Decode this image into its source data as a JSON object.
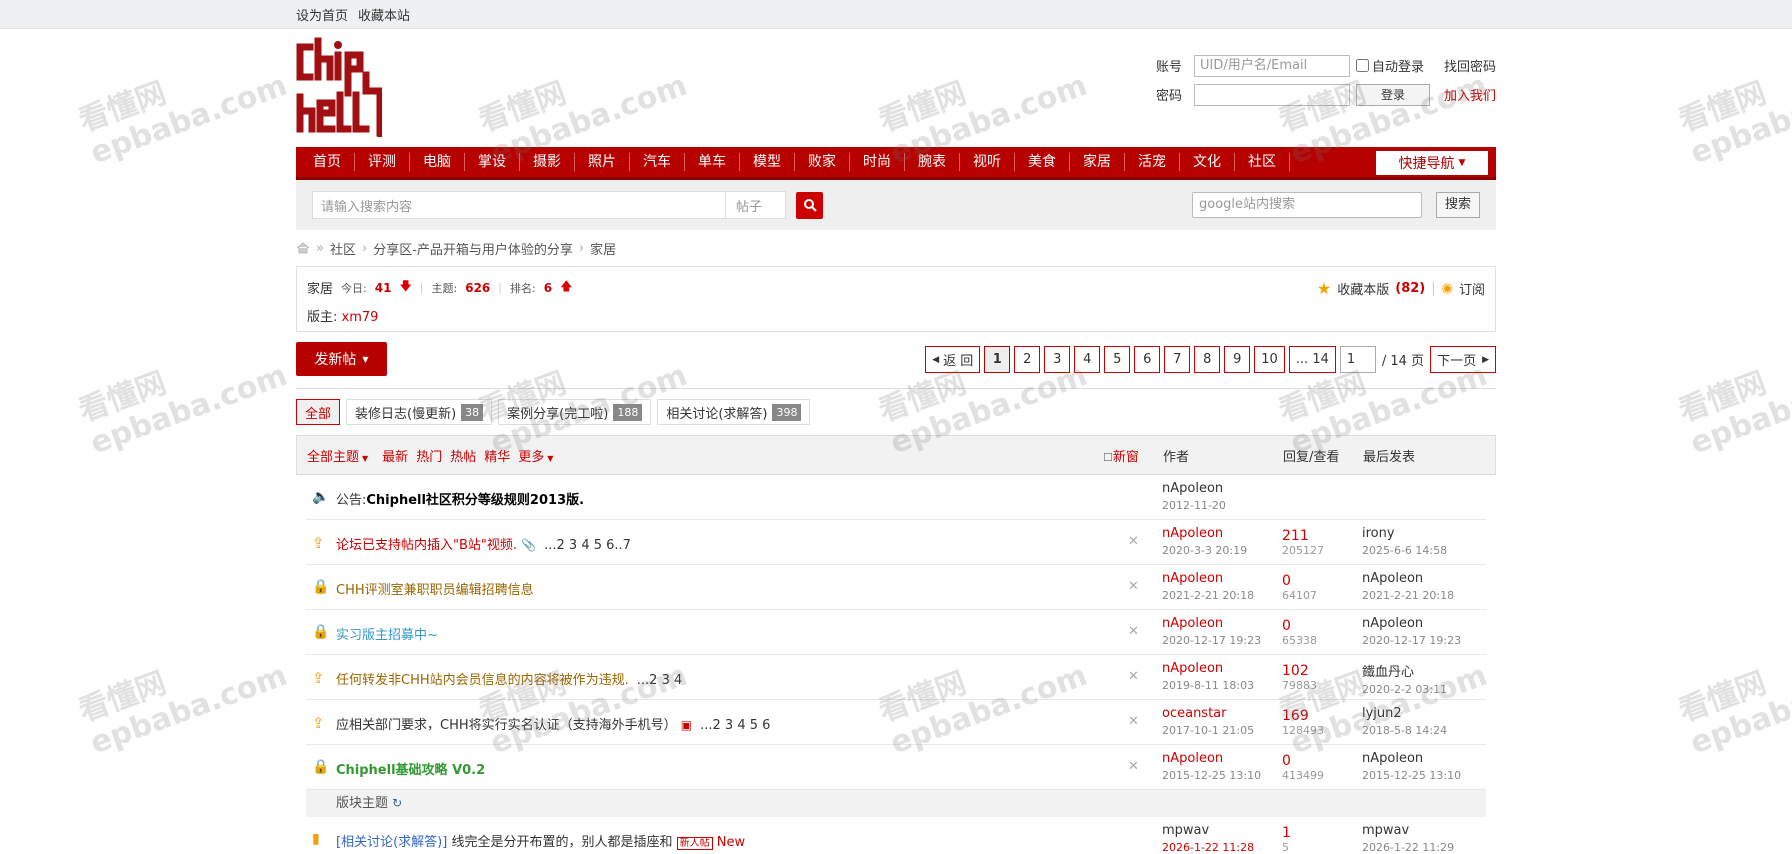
{
  "topbar": {
    "set_home": "设为首页",
    "bookmark": "收藏本站"
  },
  "login": {
    "account_label": "账号",
    "account_placeholder": "UID/用户名/Email",
    "auto_login": "自动登录",
    "find_password": "找回密码",
    "password_label": "密码",
    "login_button": "登录",
    "join_us": "加入我们"
  },
  "nav": {
    "items": [
      "首页",
      "评测",
      "电脑",
      "掌设",
      "摄影",
      "照片",
      "汽车",
      "单车",
      "模型",
      "败家",
      "时尚",
      "腕表",
      "视听",
      "美食",
      "家居",
      "活宠",
      "文化",
      "社区"
    ],
    "quick": "快捷导航"
  },
  "search": {
    "placeholder": "请输入搜索内容",
    "type": "帖子",
    "google_placeholder": "google站内搜索",
    "google_button": "搜索"
  },
  "breadcrumb": {
    "items": [
      "社区",
      "分享区-产品开箱与用户体验的分享",
      "家居"
    ]
  },
  "forum": {
    "name": "家居",
    "today_label": "今日:",
    "today": "41",
    "threads_label": "主题:",
    "threads": "626",
    "rank_label": "排名:",
    "rank": "6",
    "moderator_label": "版主:",
    "moderator": "xm79",
    "favorite_label": "收藏本版",
    "favorite_count": "(82)",
    "subscribe": "订阅"
  },
  "toolbar": {
    "post_button": "发新帖"
  },
  "pager": {
    "back": "返 回",
    "pages": [
      "1",
      "2",
      "3",
      "4",
      "5",
      "6",
      "7",
      "8",
      "9",
      "10",
      "... 14"
    ],
    "current": "1",
    "total": "/ 14 页",
    "next": "下一页"
  },
  "tabs": [
    {
      "label": "全部",
      "count": ""
    },
    {
      "label": "装修日志(慢更新)",
      "count": "38"
    },
    {
      "label": "案例分享(完工啦)",
      "count": "188"
    },
    {
      "label": "相关讨论(求解答)",
      "count": "398"
    }
  ],
  "thread_header": {
    "filters": [
      "全部主题",
      "最新",
      "热门",
      "热帖",
      "精华",
      "更多"
    ],
    "new_window": "新窗",
    "author": "作者",
    "replies": "回复/查看",
    "last_post": "最后发表"
  },
  "threads": [
    {
      "prefix": "公告:",
      "title": "Chiphell社区积分等级规则2013版.",
      "pages": "",
      "author": "nApoleon",
      "date": "2012-11-20",
      "replies": "",
      "views": "",
      "last_author": "",
      "last_date": "",
      "color": "#000"
    },
    {
      "prefix": "",
      "title": "论坛已支持帖内插入\"B站\"视频.",
      "pages": "...2 3 4 5 6..7",
      "author": "nApoleon",
      "date": "2020-3-3 20:19",
      "replies": "211",
      "views": "205127",
      "last_author": "irony",
      "last_date": "2025-6-6 14:58",
      "color": "#c00"
    },
    {
      "prefix": "",
      "title": "CHH评测室兼职职员编辑招聘信息",
      "pages": "",
      "author": "nApoleon",
      "date": "2021-2-21 20:18",
      "replies": "0",
      "views": "64107",
      "last_author": "nApoleon",
      "last_date": "2021-2-21 20:18",
      "color": "#996600"
    },
    {
      "prefix": "",
      "title": "实习版主招募中~",
      "pages": "",
      "author": "nApoleon",
      "date": "2020-12-17 19:23",
      "replies": "0",
      "views": "65338",
      "last_author": "nApoleon",
      "last_date": "2020-12-17 19:23",
      "color": "#3399cc"
    },
    {
      "prefix": "",
      "title": "任何转发非CHH站内会员信息的内容将被作为违规.",
      "pages": "...2 3 4",
      "author": "nApoleon",
      "date": "2019-8-11 18:03",
      "replies": "102",
      "views": "79883",
      "last_author": "鐵血丹心",
      "last_date": "2020-2-2 03:11",
      "color": "#996600"
    },
    {
      "prefix": "",
      "title": "应相关部门要求，CHH将实行实名认证（支持海外手机号）",
      "pages": "...2 3 4 5 6",
      "author": "oceanstar",
      "date": "2017-10-1 21:05",
      "replies": "169",
      "views": "128493",
      "last_author": "lyjun2",
      "last_date": "2018-5-8 14:24",
      "color": "#333"
    },
    {
      "prefix": "",
      "title": "Chiphell基础攻略 V0.2",
      "pages": "",
      "author": "nApoleon",
      "date": "2015-12-25 13:10",
      "replies": "0",
      "views": "413499",
      "last_author": "nApoleon",
      "last_date": "2015-12-25 13:10",
      "color": "#339933"
    }
  ],
  "section_label": "版块主题",
  "last_thread": {
    "category": "[相关讨论(求解答)]",
    "title": "线完全是分开布置的，别人都是插座和",
    "new_badge": "新人帖",
    "new_label": "New",
    "author": "mpwav",
    "date": "2026-1-22 11:28",
    "replies": "1",
    "views": "5",
    "last_author": "mpwav",
    "last_date": "2026-1-22 11:29"
  },
  "watermark": {
    "name": "看懂网",
    "url": "epbaba.com"
  },
  "colors": {
    "brand_red": "#b70000",
    "accent": "#cc0000"
  }
}
